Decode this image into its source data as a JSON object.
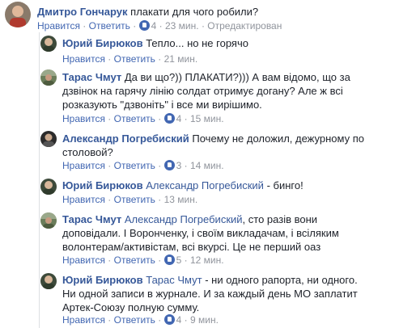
{
  "comments": [
    {
      "author": "Дмитро Гончарук",
      "text": "плакати для чого робили?",
      "like_label": "Нравится",
      "reply_label": "Ответить",
      "likes": "4",
      "time": "23 мин.",
      "edited": "Отредактирован"
    },
    {
      "author": "Юрий Бирюков",
      "text": "Тепло... но не горячо",
      "like_label": "Нравится",
      "reply_label": "Ответить",
      "time": "21 мин."
    },
    {
      "author": "Тарас Чмут",
      "text_line1": "Да ви що?)) ПЛАКАТИ?))) А вам відомо, що за",
      "text_line2": "дзвінок на гарячу лінію солдат отримує догану? Але ж всі",
      "text_line3": "розказують \"дзвоніть\" і все ми вирішимо.",
      "like_label": "Нравится",
      "reply_label": "Ответить",
      "likes": "4",
      "time": "15 мин."
    },
    {
      "author": "Александр Погребиский",
      "text_line1": "Почему не доложил, дежурному по",
      "text_line2": "столовой?",
      "like_label": "Нравится",
      "reply_label": "Ответить",
      "likes": "3",
      "time": "14 мин."
    },
    {
      "author": "Юрий Бирюков",
      "mention": "Александр Погребиский",
      "text": "- бинго!",
      "like_label": "Нравится",
      "reply_label": "Ответить",
      "time": "13 мин."
    },
    {
      "author": "Тарас Чмут",
      "mention": "Александр Погребиский",
      "text_line1": ", сто разів вони",
      "text_line2": "доповідали. І Воронченку, і своїм викладачам, і всіляким",
      "text_line3": "волонтерам/активістам, всі вкурсі. Це не перший оаз",
      "like_label": "Нравится",
      "reply_label": "Ответить",
      "likes": "5",
      "time": "12 мин."
    },
    {
      "author": "Юрий Бирюков",
      "mention": "Тарас Чмут",
      "text_line1": "- ни одного рапорта, ни одного.",
      "text_line2": "Ни одной записи в журнале. И за каждый день МО заплатит",
      "text_line3": "Артек-Союзу полную сумму.",
      "like_label": "Нравится",
      "reply_label": "Ответить",
      "likes": "4",
      "time": "9 мин."
    }
  ],
  "separator": "·",
  "colors": {
    "link": "#365899",
    "action": "#4267b2",
    "meta": "#90949c",
    "text": "#1d2129"
  }
}
